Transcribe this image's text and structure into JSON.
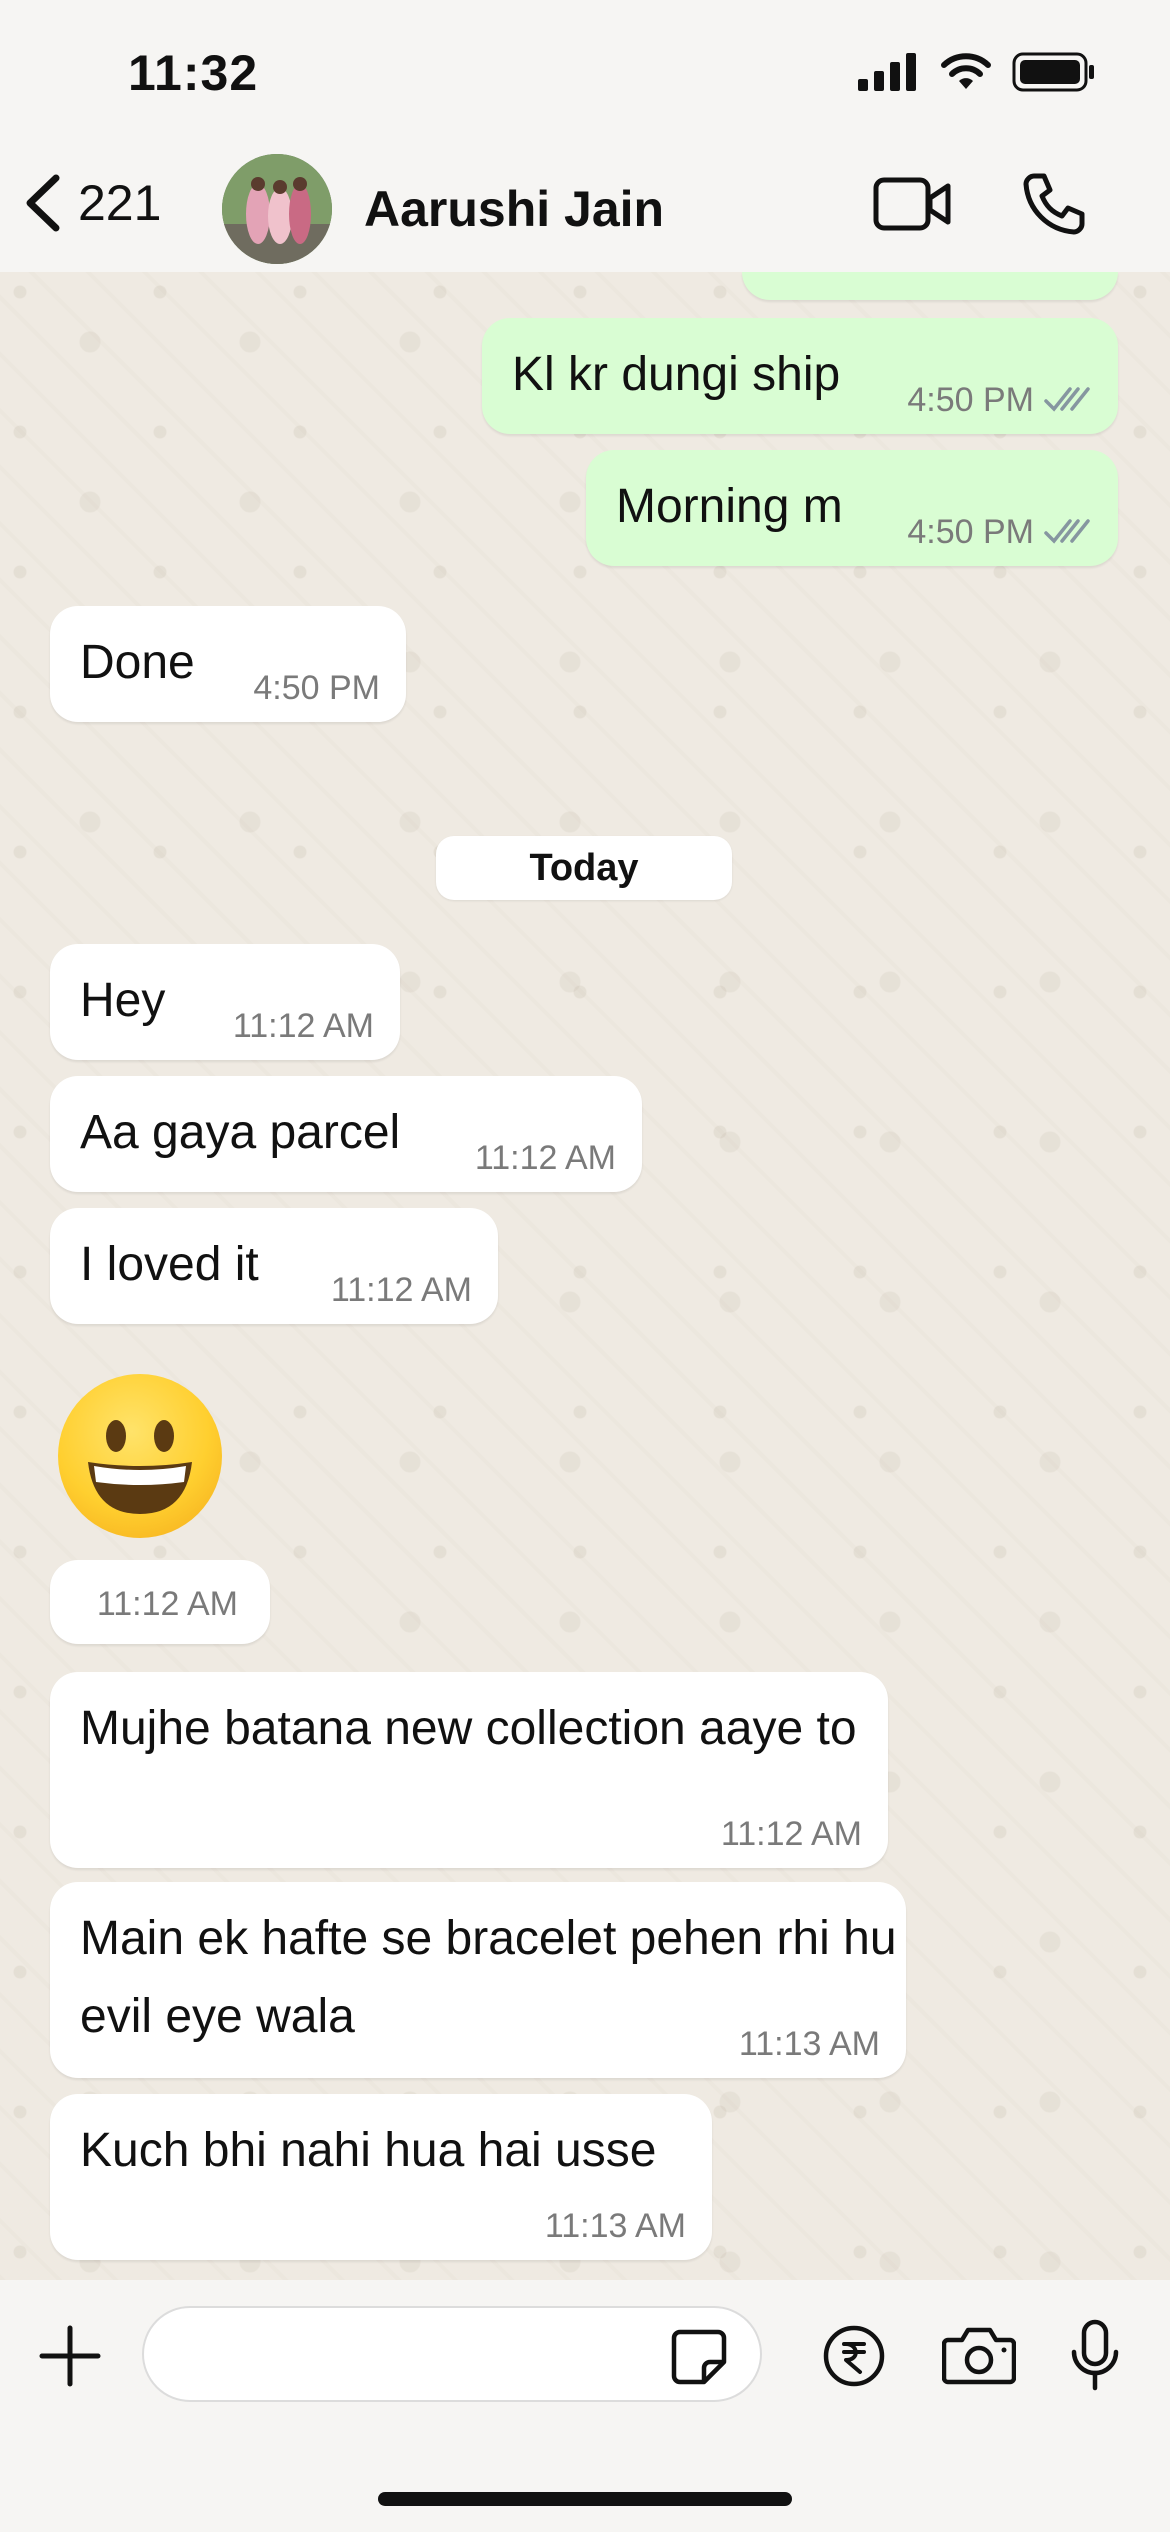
{
  "status_bar": {
    "time": "11:32"
  },
  "header": {
    "back_count": "221",
    "contact_name": "Aarushi Jain",
    "icons": [
      "chevron-left-icon",
      "video-call-icon",
      "phone-icon"
    ]
  },
  "messages": [
    {
      "direction": "out",
      "text": "Kl kr dungi ship",
      "time": "4:50 PM",
      "status": "read"
    },
    {
      "direction": "out",
      "text": "Morning m",
      "time": "4:50 PM",
      "status": "read"
    },
    {
      "direction": "in",
      "text": "Done",
      "time": "4:50 PM"
    },
    {
      "direction": "in",
      "text": "Hey",
      "time": "11:12 AM"
    },
    {
      "direction": "in",
      "text": "Aa gaya parcel",
      "time": "11:12 AM"
    },
    {
      "direction": "in",
      "text": "I loved it",
      "time": "11:12 AM"
    },
    {
      "direction": "in",
      "text": "😀",
      "time": "11:12 AM"
    },
    {
      "direction": "in",
      "text": "Mujhe batana new collection aaye to",
      "time": "11:12 AM"
    },
    {
      "direction": "in",
      "text": "Main ek hafte se bracelet pehen rhi hu evil eye wala",
      "time": "11:13 AM"
    },
    {
      "direction": "in",
      "text": "Kuch bhi nahi hua hai usse",
      "time": "11:13 AM"
    }
  ],
  "day_separator": "Today",
  "input_bar": {
    "placeholder": "",
    "icons": [
      "plus-icon",
      "sticker-icon",
      "rupee-icon",
      "camera-icon",
      "mic-icon"
    ]
  },
  "colors": {
    "outgoing_bubble": "#d9fdd3",
    "incoming_bubble": "#ffffff",
    "chat_background": "#efeae2",
    "read_ticks": "#8696a0"
  }
}
